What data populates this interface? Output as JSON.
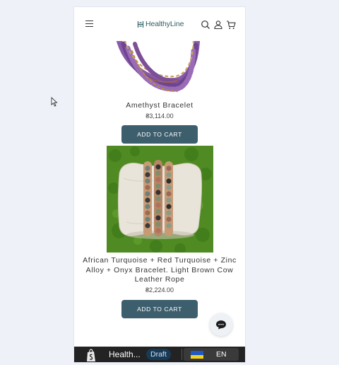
{
  "header": {
    "menu_icon": "hamburger-icon",
    "logo_text": "HealthyLine",
    "icons": [
      "search-icon",
      "user-icon",
      "cart-icon"
    ]
  },
  "products": [
    {
      "title": "Amethyst Bracelet",
      "price": "₴3,114.00",
      "button_label": "ADD TO CART",
      "image": "amethyst-bracelet-image"
    },
    {
      "title": "African Turquoise + Red Turquoise + Zinc Alloy + Onyx Bracelet. Light Brown Cow Leather Rope",
      "price": "₴2,224.00",
      "button_label": "ADD TO CART",
      "image": "stacked-bracelets-image"
    }
  ],
  "chat": {
    "icon": "chat-icon"
  },
  "preview_bar": {
    "store_name": "Health...",
    "status": "Draft",
    "language": "EN",
    "flag": "ukraine-flag-icon"
  },
  "colors": {
    "accent": "#3d5e6c",
    "logo": "#2d5f64",
    "page_bg": "#eef1f8"
  }
}
